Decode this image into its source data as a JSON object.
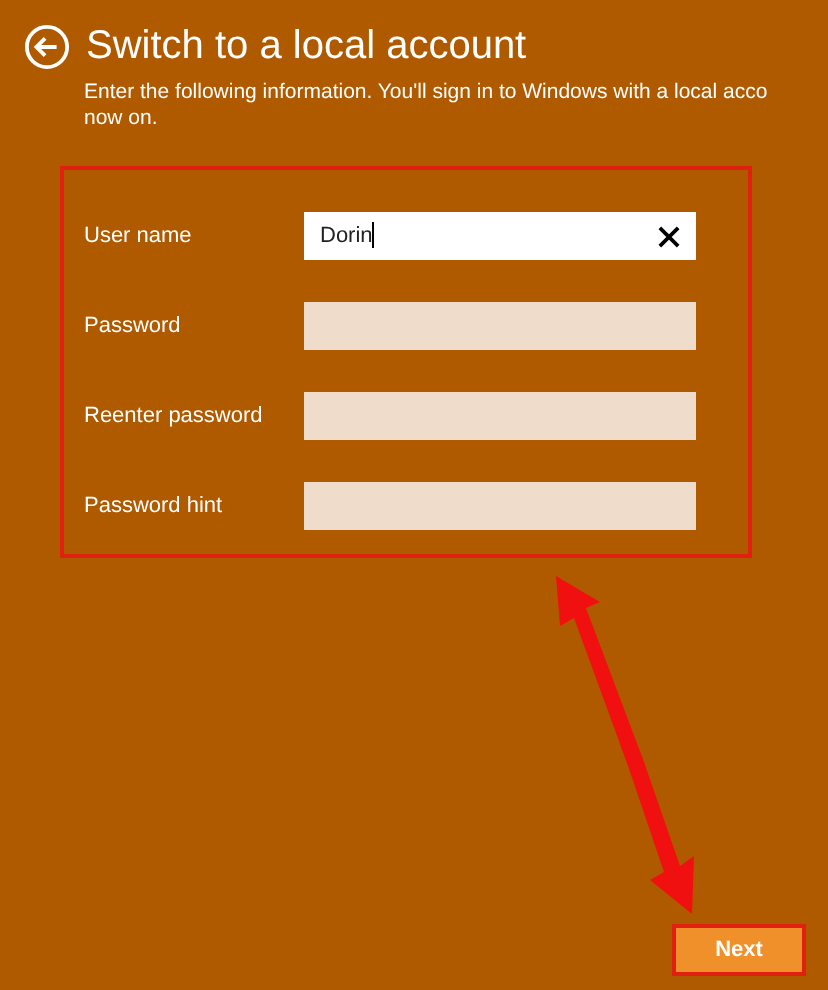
{
  "title": "Switch to a local account",
  "description_line_1": "Enter the following information. You'll sign in to Windows with a local acco",
  "description_line_2": "now on.",
  "fields": [
    {
      "label": "User name",
      "value": "Dorin",
      "focused": true
    },
    {
      "label": "Password",
      "focused": false
    },
    {
      "label": "Reenter password",
      "focused": false
    },
    {
      "label": "Password hint",
      "focused": false
    }
  ],
  "next_button": "Next"
}
